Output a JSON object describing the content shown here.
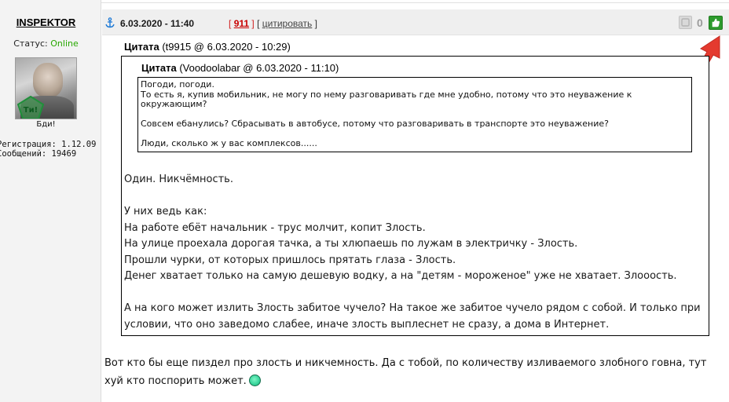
{
  "author": {
    "username": "INSPEKTOR",
    "status_label": "Статус:",
    "status_value": "Online",
    "avatar_caption": "Бди!",
    "avatar_badge_text": "Ти!",
    "registration": "Регистрация: 1.12.09",
    "messages": "Сообщений: 19469"
  },
  "post": {
    "date": "6.03.2020 - 11:40",
    "bracket_open": "[",
    "bracket_close": "]",
    "reply_number": "911",
    "cite_label": "цитировать",
    "vote_count": "0"
  },
  "quote_outer": {
    "label": "Цитата",
    "meta": "(t9915 @ 6.03.2020 - 10:29)",
    "paragraphs": [
      "Один. Никчёмность.",
      "У них ведь как:",
      "На работе ебёт начальник - трус молчит, копит Злость.",
      "На улице проехала дорогая тачка, а ты хлюпаешь по лужам в электричку - Злость.",
      "Прошли чурки, от которых пришлось прятать глаза - Злость.",
      "Денег хватает только на самую дешевую водку, а на \"детям - мороженое\" уже не хватает. Злоoость.",
      "А на кого может излить Злость забитое чучело? На такое же забитое чучело рядом с собой. И только при условии, что оно заведомо слабее, иначе злость выплеснет не сразу, а дома в Интернет."
    ]
  },
  "quote_inner": {
    "label": "Цитата",
    "meta": "(Voodoolabar @ 6.03.2020 - 11:10)",
    "paragraphs": [
      "Погоди, погоди.",
      "То есть я, купив мобильник, не могу по нему разговаривать где мне удобно, потому что это неуважение к окружающим?",
      "Совсем ебанулись? Сбрасывать в автобусе, потому что разговаривать в транспорте это неуважение?",
      "Люди, сколько ж у вас комплексов......"
    ]
  },
  "reply": {
    "text": "Вот кто бы еще пиздел про злость и никчемность. Да с тобой, по количеству изливаемого злобного говна, тут хуй кто поспорить может."
  },
  "colors": {
    "online": "#27a800",
    "reply_number": "#c80000",
    "like_green": "#2d9b2d",
    "arrow_red": "#e43a2f",
    "anchor_blue": "#1e7ad6"
  },
  "icons": [
    "anchor-icon",
    "dislike-icon",
    "like-icon",
    "smiley-icon",
    "arrow-icon"
  ]
}
